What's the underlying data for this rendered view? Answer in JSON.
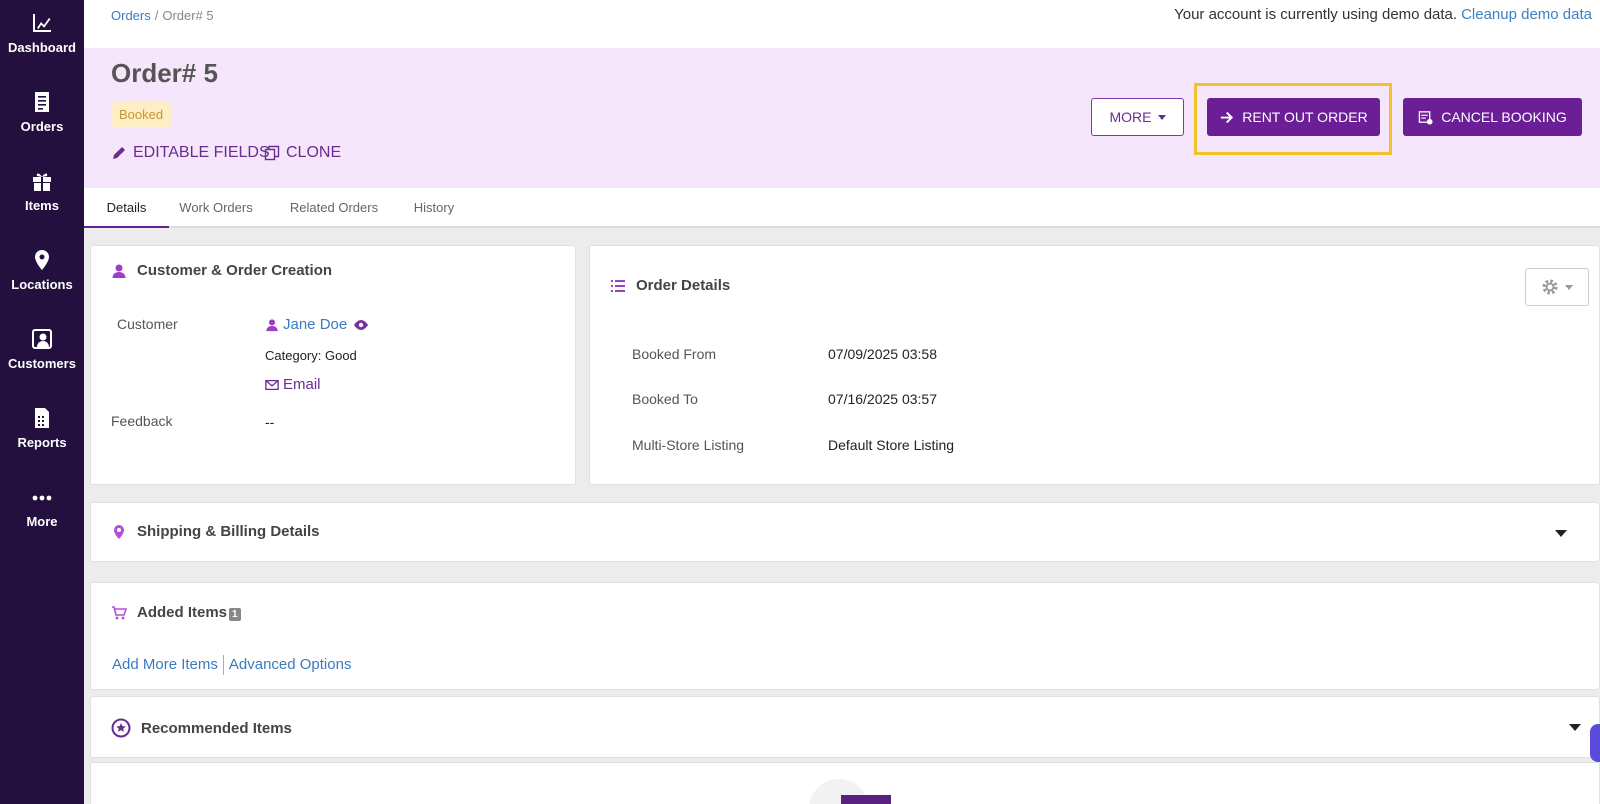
{
  "sidebar": {
    "items": [
      {
        "label": "Dashboard",
        "icon": "dashboard-icon"
      },
      {
        "label": "Orders",
        "icon": "orders-icon"
      },
      {
        "label": "Items",
        "icon": "items-icon"
      },
      {
        "label": "Locations",
        "icon": "location-pin-icon"
      },
      {
        "label": "Customers",
        "icon": "customers-icon"
      },
      {
        "label": "Reports",
        "icon": "reports-icon"
      },
      {
        "label": "More",
        "icon": "more-dots-icon"
      }
    ]
  },
  "topbar": {
    "breadcrumb": {
      "root": "Orders",
      "separator": "/",
      "current": "Order# 5"
    },
    "demo_message": "Your account is currently using demo data.",
    "cleanup_link": "Cleanup demo data"
  },
  "header": {
    "title": "Order# 5",
    "status": "Booked",
    "editable_fields": "EDITABLE FIELDS",
    "clone": "CLONE",
    "more_button": "MORE",
    "rent_out_button": "RENT OUT ORDER",
    "cancel_button": "CANCEL BOOKING"
  },
  "tabs": [
    {
      "label": "Details",
      "active": true
    },
    {
      "label": "Work Orders",
      "active": false
    },
    {
      "label": "Related Orders",
      "active": false
    },
    {
      "label": "History",
      "active": false
    }
  ],
  "customer_card": {
    "title": "Customer & Order Creation",
    "customer_label": "Customer",
    "customer_name": "Jane Doe",
    "category": "Category: Good",
    "email_link": "Email",
    "feedback_label": "Feedback",
    "feedback_value": "--"
  },
  "order_details": {
    "title": "Order Details",
    "fields": [
      {
        "label": "Booked From",
        "value": "07/09/2025 03:58"
      },
      {
        "label": "Booked To",
        "value": "07/16/2025 03:57"
      },
      {
        "label": "Multi-Store Listing",
        "value": "Default Store Listing"
      }
    ]
  },
  "shipping": {
    "title": "Shipping & Billing Details"
  },
  "added_items": {
    "title": "Added Items",
    "count": "1",
    "add_more": "Add More Items",
    "advanced": "Advanced Options"
  },
  "recommended": {
    "title": "Recommended Items"
  },
  "colors": {
    "sidebar": "#23103f",
    "primary": "#6b1f96",
    "header_band": "#f5e6fb",
    "highlight": "#f2c22b"
  }
}
